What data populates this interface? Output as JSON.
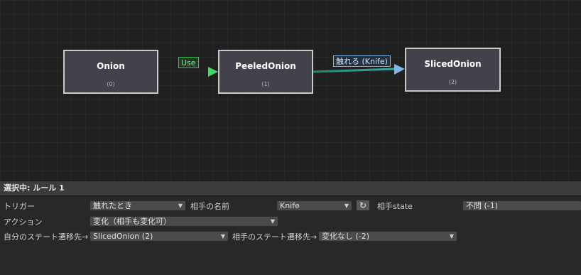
{
  "graph": {
    "nodes": [
      {
        "title": "Onion",
        "index": "(0)"
      },
      {
        "title": "PeeledOnion",
        "index": "(1)"
      },
      {
        "title": "SlicedOnion",
        "index": "(2)"
      }
    ],
    "edges": [
      {
        "label": "Use",
        "color": "#3fbf5a"
      },
      {
        "label": "触れる (Knife)",
        "color": "#6fa8dc"
      }
    ]
  },
  "panel": {
    "header": "選択中: ルール 1",
    "trigger": {
      "label": "トリガー",
      "value": "触れたとき"
    },
    "partner_name": {
      "label": "相手の名前",
      "value": "Knife"
    },
    "refresh_icon": "refresh-icon",
    "partner_state": {
      "label": "相手state",
      "value": "不問 (-1)"
    },
    "action": {
      "label": "アクション",
      "value": "変化（相手も変化可）"
    },
    "self_transition": {
      "label": "自分のステート遷移先→",
      "value": "SlicedOnion (2)"
    },
    "partner_transition": {
      "label": "相手のステート遷移先→",
      "value": "変化なし (-2)"
    }
  }
}
